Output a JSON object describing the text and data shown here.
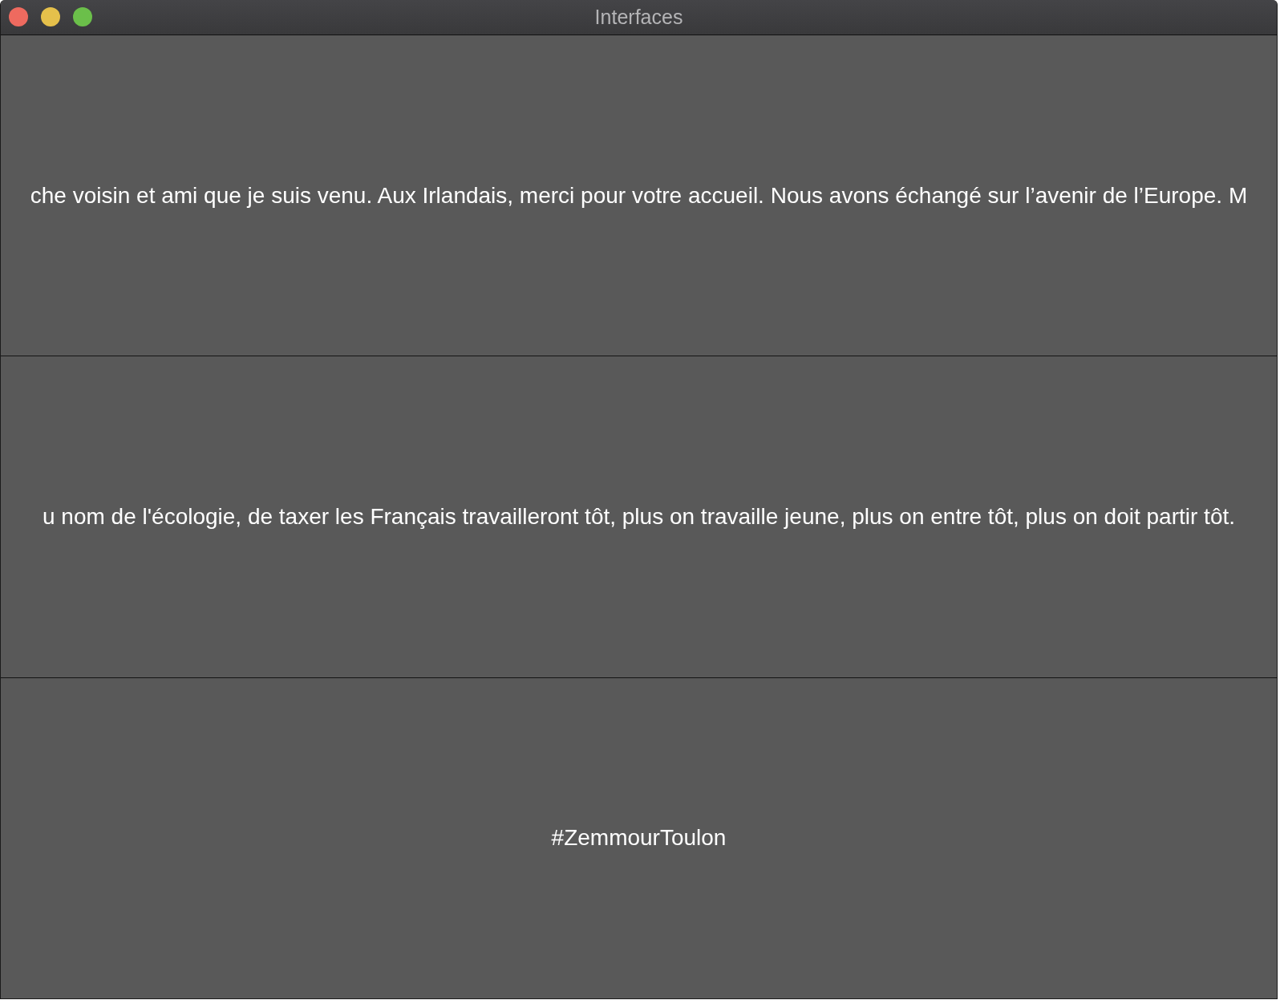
{
  "window": {
    "title": "Interfaces",
    "controls": [
      {
        "kind": "close"
      },
      {
        "kind": "minimize"
      },
      {
        "kind": "maximize"
      }
    ]
  },
  "rows": [
    {
      "text": "che voisin et ami que je suis venu. Aux Irlandais, merci pour votre accueil. Nous avons échangé sur l’avenir de l’Europe. M"
    },
    {
      "text": "u nom de l'écologie, de taxer les Français travailleront tôt, plus on travaille jeune, plus on entre tôt, plus on doit partir tôt."
    },
    {
      "text": "#ZemmourToulon"
    }
  ]
}
